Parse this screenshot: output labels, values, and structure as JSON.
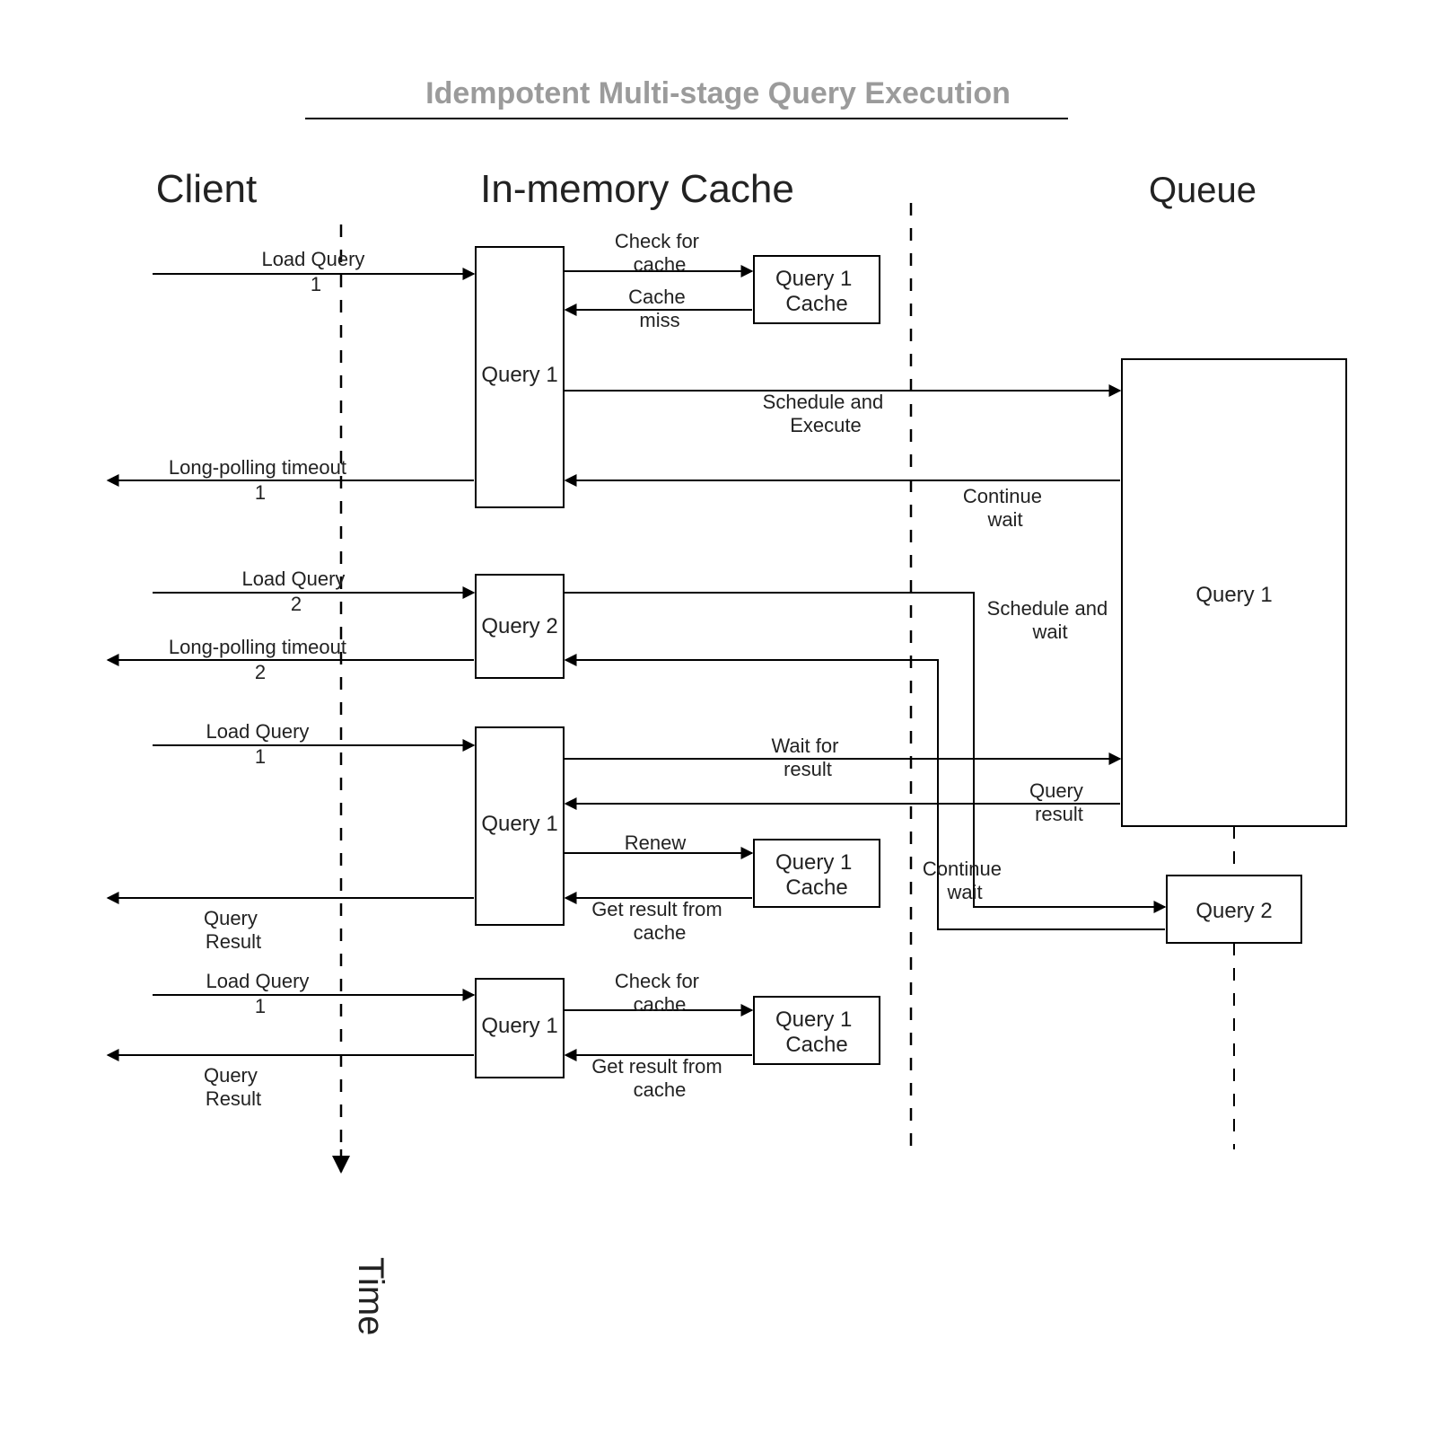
{
  "title": "Idempotent Multi-stage Query Execution",
  "lanes": {
    "client": "Client",
    "cache": "In-memory Cache",
    "queue": "Queue"
  },
  "axis": "Time",
  "boxes": {
    "q1a": "Query 1",
    "q1cache_a": "Query 1\nCache",
    "q2": "Query 2",
    "q1b": "Query 1",
    "q1cache_b": "Query 1\nCache",
    "q1c": "Query 1",
    "q1cache_c": "Query 1\nCache",
    "queueQ1": "Query 1",
    "queueQ2": "Query 2"
  },
  "messages": {
    "loadQ1_1": "Load Query\n1",
    "checkCache1": "Check for\ncache",
    "cacheMiss": "Cache\nmiss",
    "schedExec": "Schedule and\nExecute",
    "lpTimeout1": "Long-polling timeout\n1",
    "contWait1": "Continue\nwait",
    "loadQ2": "Load Query\n2",
    "schedWait": "Schedule and\nwait",
    "lpTimeout2": "Long-polling timeout\n2",
    "loadQ1_2": "Load Query\n1",
    "waitResult": "Wait for\nresult",
    "queryResult": "Query\nresult",
    "renew": "Renew",
    "contWait2": "Continue\nwait",
    "getFromCache1": "Get result from\ncache",
    "qResult1": "Query\nResult",
    "loadQ1_3": "Load Query\n1",
    "checkCache2": "Check for\ncache",
    "getFromCache2": "Get result from\ncache",
    "qResult2": "Query\nResult"
  }
}
